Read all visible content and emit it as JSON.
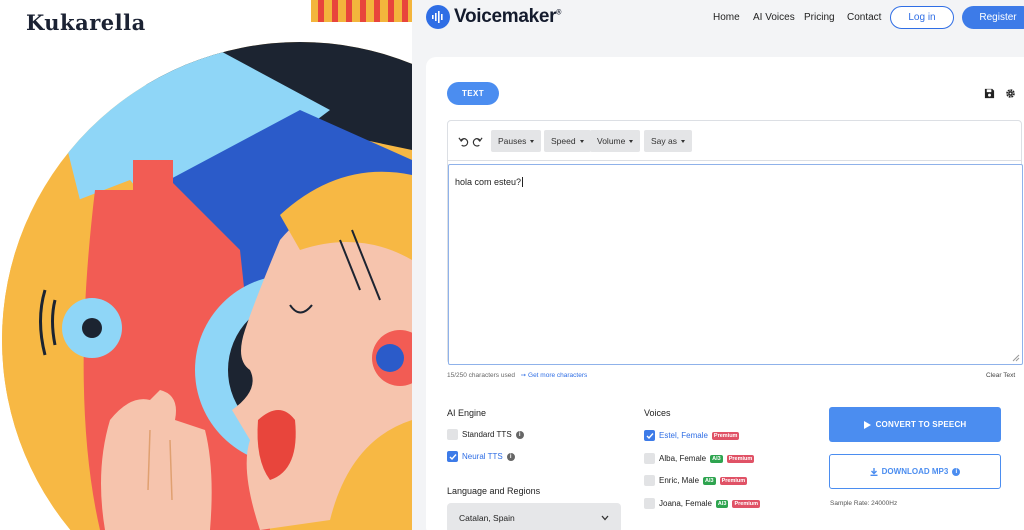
{
  "brand": {
    "name": "Kukarella"
  },
  "nav": {
    "logo_text": "Voicemaker",
    "logo_mark": "®",
    "links": [
      "Home",
      "AI Voices",
      "Pricing",
      "Contact"
    ],
    "login_label": "Log in",
    "register_label": "Register"
  },
  "editor": {
    "tab_label": "TEXT",
    "dropdowns": [
      "Pauses",
      "Speed",
      "Volume",
      "Say as"
    ],
    "text": "hola com esteu?",
    "counter": "15/250 characters used",
    "more_link": "Get more characters",
    "clear_label": "Clear Text"
  },
  "engine": {
    "title": "AI Engine",
    "options": [
      {
        "label": "Standard TTS",
        "checked": false
      },
      {
        "label": "Neural TTS",
        "checked": true
      }
    ]
  },
  "voices": {
    "title": "Voices",
    "items": [
      {
        "label": "Estel, Female",
        "ai3": "",
        "premium": "Premium",
        "checked": true
      },
      {
        "label": "Alba, Female",
        "ai3": "AI3",
        "premium": "Premium",
        "checked": false
      },
      {
        "label": "Enric, Male",
        "ai3": "AI3",
        "premium": "Premium",
        "checked": false
      },
      {
        "label": "Joana, Female",
        "ai3": "AI3",
        "premium": "Premium",
        "checked": false
      }
    ]
  },
  "language": {
    "title": "Language and Regions",
    "selected": "Catalan, Spain"
  },
  "actions": {
    "convert_label": "CONVERT TO SPEECH",
    "download_label": "DOWNLOAD MP3",
    "sample_rate": "Sample Rate: 24000Hz"
  },
  "colors": {
    "accent": "#4b8df0",
    "premium": "#e05266",
    "ai3": "#2ea44f"
  },
  "icons": [
    "undo-icon",
    "redo-icon",
    "save-icon",
    "gear-icon",
    "play-icon",
    "download-icon",
    "info-icon",
    "chevron-down-icon",
    "check-icon"
  ]
}
